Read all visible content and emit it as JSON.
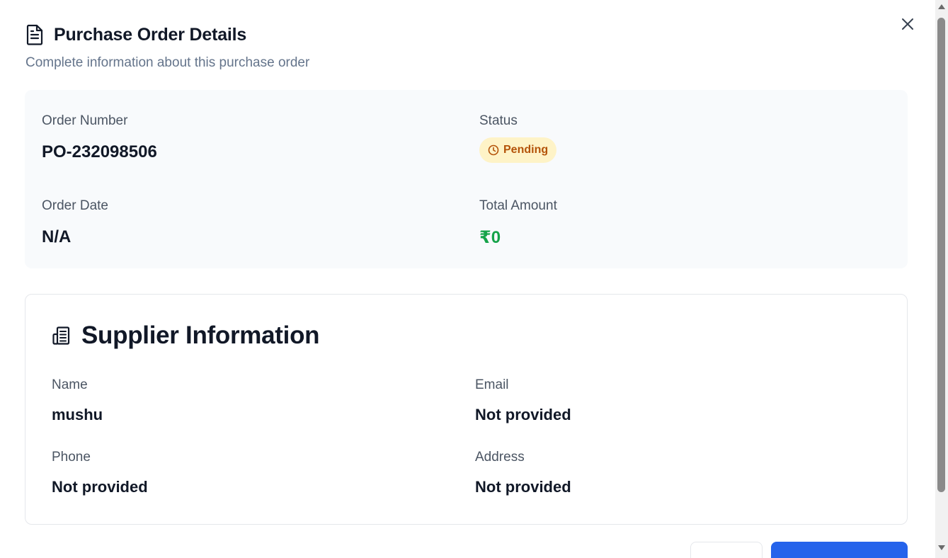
{
  "dialog": {
    "title": "Purchase Order Details",
    "subtitle": "Complete information about this purchase order",
    "title_icon": "document-icon",
    "close_icon": "close-icon"
  },
  "summary": {
    "order_number_label": "Order Number",
    "order_number": "PO-232098506",
    "status_label": "Status",
    "status": "Pending",
    "status_icon": "clock-icon",
    "status_color": "#b45309",
    "status_bg": "#fef3c7",
    "order_date_label": "Order Date",
    "order_date": "N/A",
    "total_amount_label": "Total Amount",
    "total_amount": "₹0",
    "total_amount_color": "#16a34a"
  },
  "supplier": {
    "title": "Supplier Information",
    "title_icon": "building-icon",
    "name_label": "Name",
    "name": "mushu",
    "email_label": "Email",
    "email": "Not provided",
    "phone_label": "Phone",
    "phone": "Not provided",
    "address_label": "Address",
    "address": "Not provided"
  },
  "colors": {
    "primary_button": "#2563eb",
    "card_bg": "#f8fafc"
  }
}
